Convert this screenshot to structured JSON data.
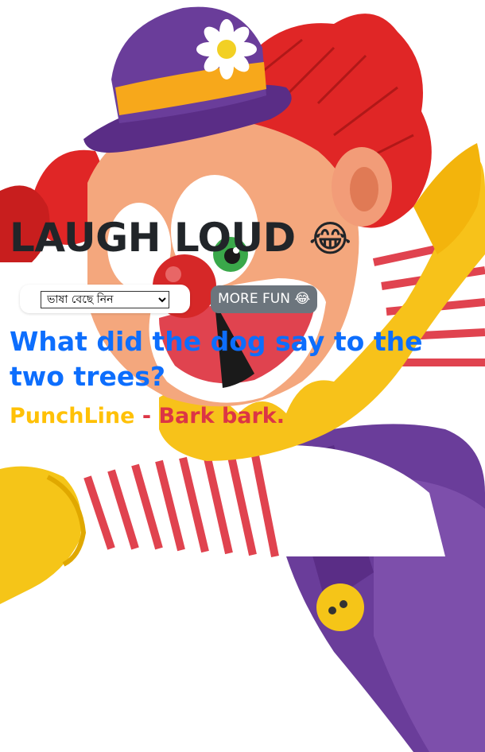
{
  "header": {
    "title": "LAUGH LOUD",
    "title_emoji": "😂"
  },
  "controls": {
    "language_select": {
      "selected": "ভাষা বেছে নিন",
      "options": [
        "ভাষা বেছে নিন"
      ]
    },
    "more_fun_label": "MORE FUN 😂"
  },
  "joke": {
    "question": "What did the dog say to the two trees?",
    "punchline_label": "PunchLine",
    "separator": " - ",
    "punchline": "Bark bark."
  },
  "colors": {
    "title": "#212529",
    "question": "#0d6efd",
    "punchline_label": "#ffc107",
    "punchline_text": "#dc3545",
    "button_bg": "#6c757d"
  },
  "icons": {
    "background": "clown-illustration",
    "select_arrow": "chevron-down-icon"
  }
}
